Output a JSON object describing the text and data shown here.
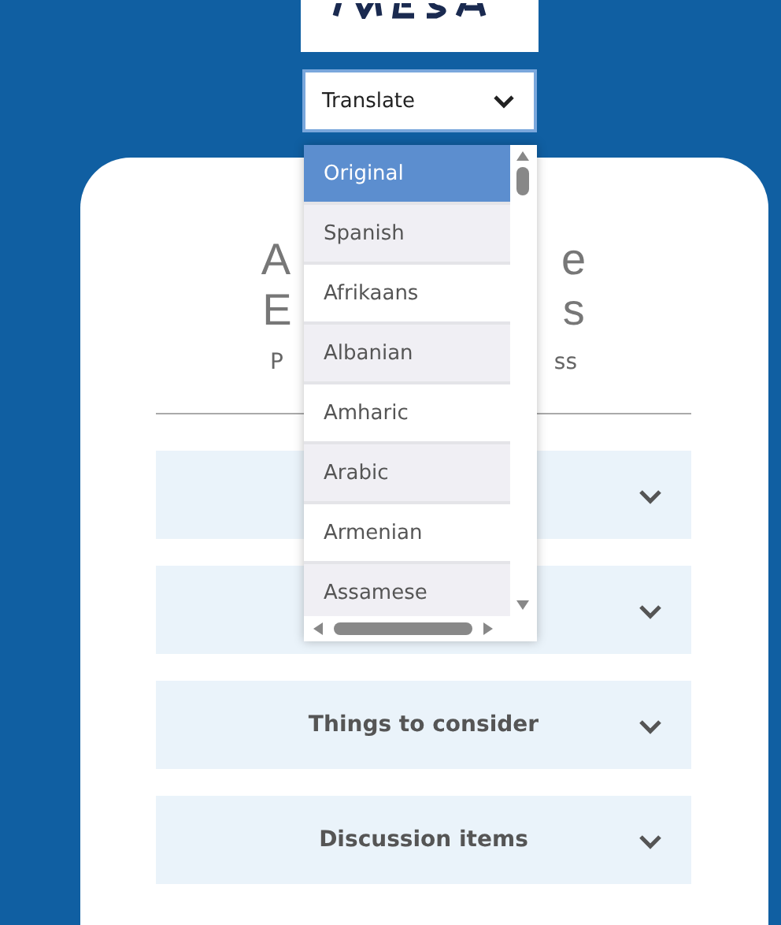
{
  "translate_select": {
    "value": "Translate"
  },
  "language_options": [
    {
      "label": "Original",
      "selected": true
    },
    {
      "label": "Spanish",
      "selected": false
    },
    {
      "label": "Afrikaans",
      "selected": false
    },
    {
      "label": "Albanian",
      "selected": false
    },
    {
      "label": "Amharic",
      "selected": false
    },
    {
      "label": "Arabic",
      "selected": false
    },
    {
      "label": "Armenian",
      "selected": false
    },
    {
      "label": "Assamese",
      "selected": false
    }
  ],
  "heading_lines": [
    {
      "left": "A",
      "right": "e"
    },
    {
      "left": "E",
      "right": "s"
    }
  ],
  "subtitle": {
    "left": "P",
    "right": "ss"
  },
  "accordion": [
    {
      "expanded": false
    },
    {
      "expanded": false
    },
    {
      "label": "Things to consider",
      "expanded": false
    },
    {
      "label": "Discussion items",
      "expanded": false
    }
  ]
}
